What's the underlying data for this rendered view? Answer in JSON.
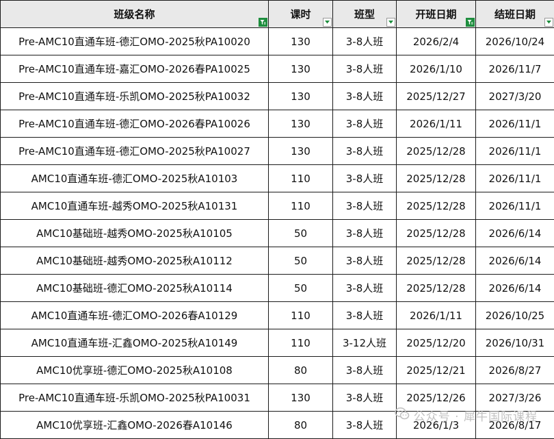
{
  "headers": [
    {
      "label": "班级名称",
      "filter": "active"
    },
    {
      "label": "课时",
      "filter": "dropdown"
    },
    {
      "label": "班型",
      "filter": "dropdown"
    },
    {
      "label": "开班日期",
      "filter": "active"
    },
    {
      "label": "结班日期",
      "filter": "dropdown"
    }
  ],
  "rows": [
    [
      "Pre-AMC10直通车班-德汇OMO-2025秋PA10020",
      "130",
      "3-8人班",
      "2026/2/4",
      "2026/10/24"
    ],
    [
      "Pre-AMC10直通车班-嘉汇OMO-2026春PA10025",
      "130",
      "3-8人班",
      "2026/1/10",
      "2026/11/7"
    ],
    [
      "Pre-AMC10直通车班-乐凯OMO-2025秋PA10032",
      "130",
      "3-8人班",
      "2025/12/27",
      "2027/3/20"
    ],
    [
      "Pre-AMC10直通车班-德汇OMO-2026春PA10026",
      "130",
      "3-8人班",
      "2026/1/11",
      "2026/11/1"
    ],
    [
      "Pre-AMC10直通车班-德汇OMO-2025秋PA10027",
      "130",
      "3-8人班",
      "2025/12/28",
      "2026/11/1"
    ],
    [
      "AMC10直通车班-德汇OMO-2025秋A10103",
      "110",
      "3-8人班",
      "2025/12/28",
      "2026/11/1"
    ],
    [
      "AMC10直通车班-越秀OMO-2025秋A10131",
      "110",
      "3-8人班",
      "2025/12/28",
      "2026/11/1"
    ],
    [
      "AMC10基础班-越秀OMO-2025秋A10105",
      "50",
      "3-8人班",
      "2025/12/28",
      "2026/6/14"
    ],
    [
      "AMC10基础班-越秀OMO-2025秋A10112",
      "50",
      "3-8人班",
      "2025/12/28",
      "2026/6/14"
    ],
    [
      "AMC10基础班-德汇OMO-2025秋A10114",
      "50",
      "3-8人班",
      "2025/12/28",
      "2026/6/14"
    ],
    [
      "AMC10直通车班-德汇OMO-2026春A10129",
      "110",
      "3-8人班",
      "2026/1/11",
      "2026/10/25"
    ],
    [
      "AMC10直通车班-汇鑫OMO-2025秋A10149",
      "110",
      "3-12人班",
      "2025/12/20",
      "2026/10/31"
    ],
    [
      "AMC10优享班-德汇OMO-2025秋A10108",
      "80",
      "3-8人班",
      "2025/12/21",
      "2026/8/27"
    ],
    [
      "Pre-AMC10直通车班-乐凯OMO-2025秋PA10031",
      "130",
      "3-8人班",
      "2025/12/26",
      "2027/3/26"
    ],
    [
      "AMC10优享班-汇鑫OMO-2026春A10146",
      "80",
      "3-8人班",
      "2026/1/3",
      "2026/8/17"
    ]
  ],
  "watermark": {
    "text": "公众号 · 犀牛国际课程",
    "icon": "wechat-icon"
  },
  "colors": {
    "header_bg": "#e9e9e9",
    "filter_active": "#1e8e3e",
    "grid": "#1a1a1a",
    "watermark": "#c2c2c2"
  }
}
